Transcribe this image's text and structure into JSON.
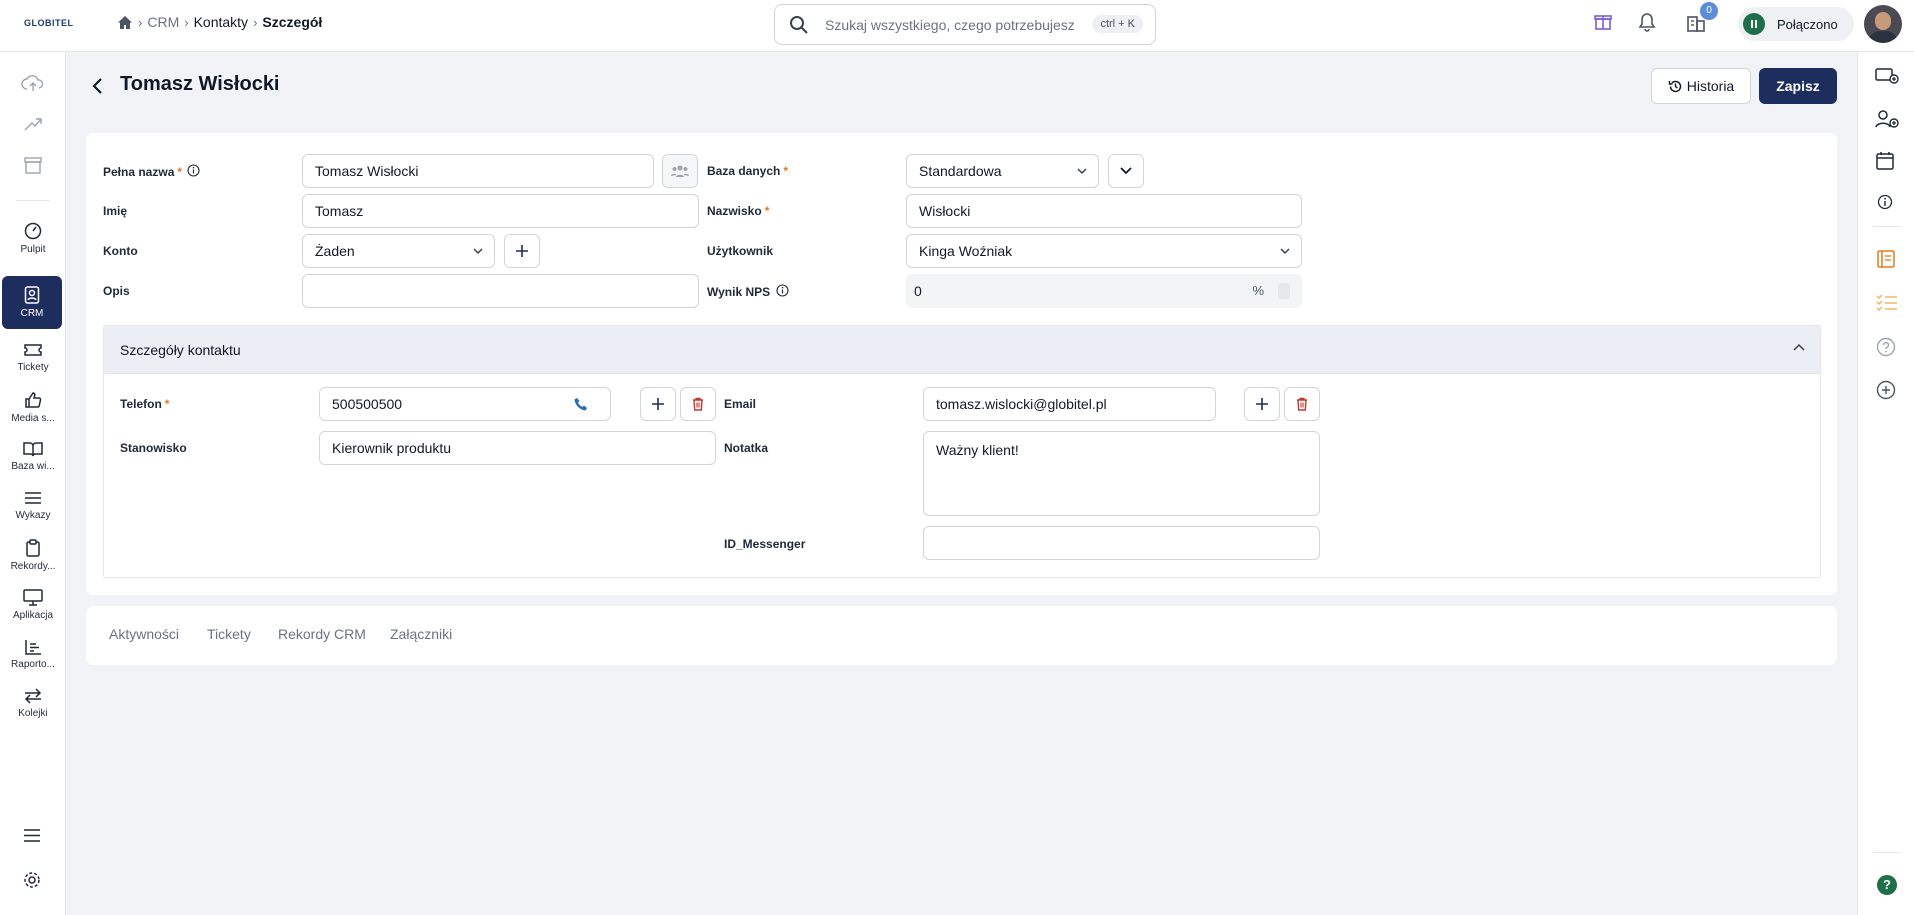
{
  "topbar": {
    "logo": "GLOBITEL",
    "breadcrumb": [
      "CRM",
      "Kontakty",
      "Szczegół"
    ],
    "search_placeholder": "Szukaj wszystkiego, czego potrzebujesz",
    "search_shortcut": "ctrl + K",
    "notification_count": "0",
    "status_label": "Połączono"
  },
  "leftnav": {
    "items": [
      {
        "label": "Pulpit",
        "icon": "gauge-icon"
      },
      {
        "label": "CRM",
        "icon": "contact-book-icon",
        "active": true
      },
      {
        "label": "Tickety",
        "icon": "ticket-icon"
      },
      {
        "label": "Media s...",
        "icon": "thumbs-up-icon"
      },
      {
        "label": "Baza wi...",
        "icon": "book-icon"
      },
      {
        "label": "Wykazy",
        "icon": "list-icon"
      },
      {
        "label": "Rekordy...",
        "icon": "clipboard-icon"
      },
      {
        "label": "Aplikacja",
        "icon": "monitor-icon"
      },
      {
        "label": "Raporto...",
        "icon": "bar-chart-icon"
      },
      {
        "label": "Kolejki",
        "icon": "arrows-swap-icon"
      }
    ]
  },
  "page": {
    "title": "Tomasz Wisłocki",
    "history_label": "Historia",
    "save_label": "Zapisz"
  },
  "form": {
    "full_name_label": "Pełna nazwa",
    "full_name_value": "Tomasz Wisłocki",
    "database_label": "Baza danych",
    "database_value": "Standardowa",
    "first_name_label": "Imię",
    "first_name_value": "Tomasz",
    "last_name_label": "Nazwisko",
    "last_name_value": "Wisłocki",
    "account_label": "Konto",
    "account_value": "Żaden",
    "user_label": "Użytkownik",
    "user_value": "Kinga Woźniak",
    "description_label": "Opis",
    "description_value": "",
    "nps_label": "Wynik NPS",
    "nps_value": "0",
    "nps_unit": "%"
  },
  "contact_details": {
    "title": "Szczegóły kontaktu",
    "phone_label": "Telefon",
    "phone_value": "500500500",
    "email_label": "Email",
    "email_value": "tomasz.wislocki@globitel.pl",
    "position_label": "Stanowisko",
    "position_value": "Kierownik produktu",
    "note_label": "Notatka",
    "note_value": "Ważny klient!",
    "messenger_label": "ID_Messenger",
    "messenger_value": ""
  },
  "tabs": [
    "Aktywności",
    "Tickety",
    "Rekordy CRM",
    "Załączniki"
  ],
  "colors": {
    "primary": "#1c2d5e",
    "required": "#e07b1f",
    "status": "#1f6f4a",
    "delete": "#c0392b"
  }
}
